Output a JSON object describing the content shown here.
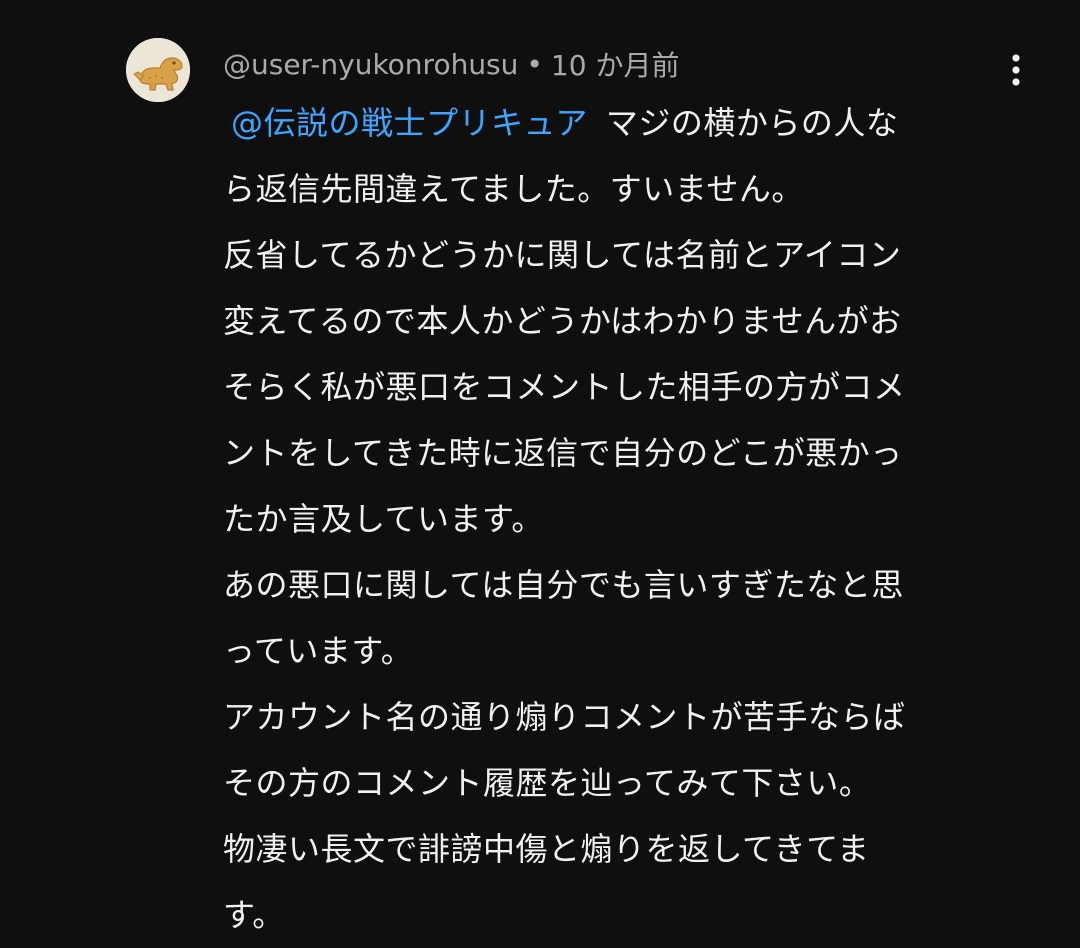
{
  "comment": {
    "author": "@user-nyukonrohusu",
    "separator": "•",
    "time": "10 か月前",
    "avatar_icon": "dinosaur-cookie-avatar",
    "menu_icon": "more-vert-icon",
    "mention": "@伝説の戦士プリキュア",
    "mention_color": "#3ea6ff",
    "lines": [
      "マジの横からの人な",
      "ら返信先間違えてました。すいません。",
      "反省してるかどうかに関しては名前とアイコン",
      "変えてるので本人かどうかはわかりませんがお",
      "そらく私が悪口をコメントした相手の方がコメ",
      "ントをしてきた時に返信で自分のどこが悪かっ",
      "たか言及しています。",
      "あの悪口に関しては自分でも言いすぎたなと思",
      "っています。",
      "アカウント名の通り煽りコメントが苦手ならば",
      "その方のコメント履歴を辿ってみて下さい。",
      "物凄い長文で誹謗中傷と煽りを返してきてま",
      "す。"
    ]
  },
  "colors": {
    "background": "#0f0f0f",
    "text": "#f1f1f1",
    "meta": "#aaaaaa",
    "link": "#3ea6ff"
  }
}
